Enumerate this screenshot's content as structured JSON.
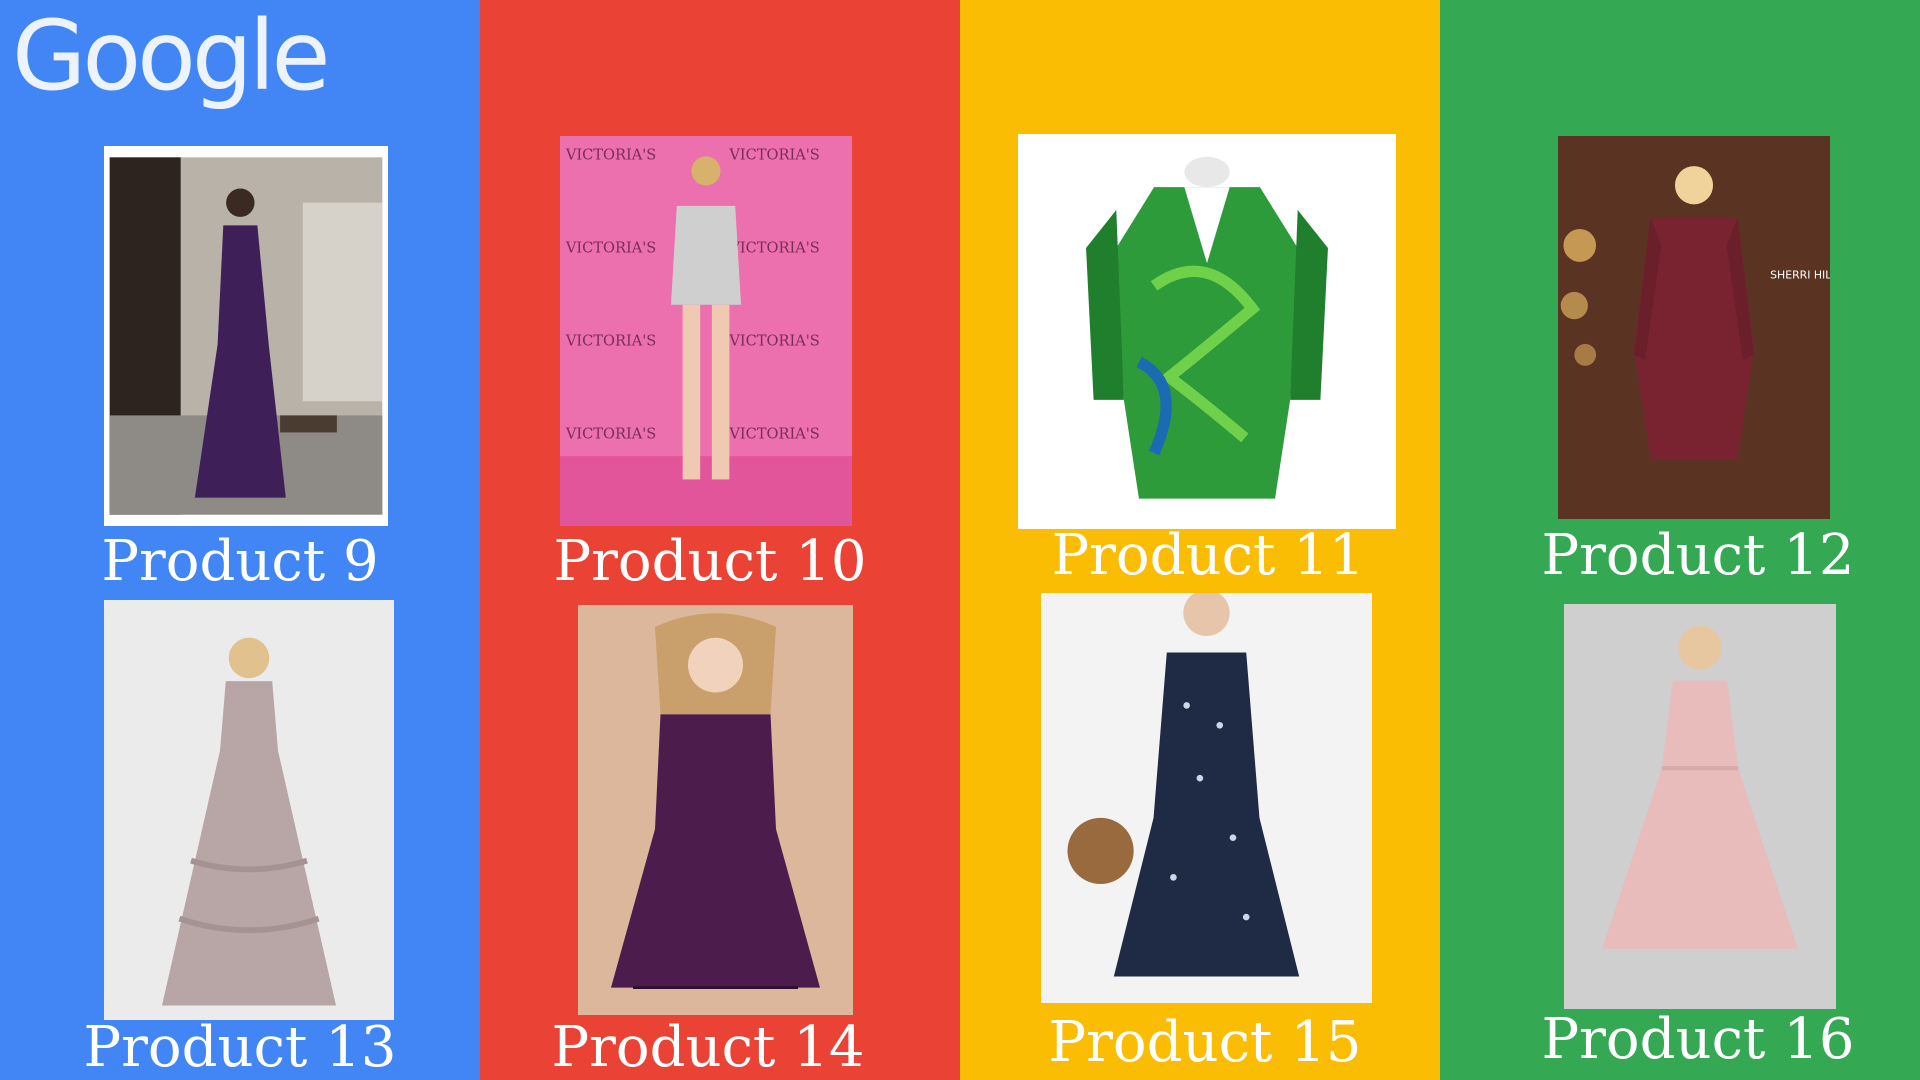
{
  "brand": {
    "logo_text": "Google",
    "colors": {
      "blue": "#4285F4",
      "red": "#EA4335",
      "yellow": "#FBBC04",
      "green": "#34A853"
    }
  },
  "products": [
    {
      "id": 9,
      "label": "Product 9",
      "image": "woman-purple-halter-gown"
    },
    {
      "id": 10,
      "label": "Product 10",
      "image": "woman-silver-strapless-mini-dress-pink-backdrop"
    },
    {
      "id": 11,
      "label": "Product 11",
      "image": "green-jungle-print-wrap-dress-on-mannequin"
    },
    {
      "id": 12,
      "label": "Product 12",
      "image": "woman-burgundy-beaded-long-sleeve-mini-dress"
    },
    {
      "id": 13,
      "label": "Product 13",
      "image": "woman-mauve-tulle-ruffle-gown"
    },
    {
      "id": 14,
      "label": "Product 14",
      "image": "woman-purple-sparkle-skater-dress"
    },
    {
      "id": 15,
      "label": "Product 15",
      "image": "woman-navy-floral-slip-dress"
    },
    {
      "id": 16,
      "label": "Product 16",
      "image": "woman-blush-halter-skater-dress"
    }
  ]
}
